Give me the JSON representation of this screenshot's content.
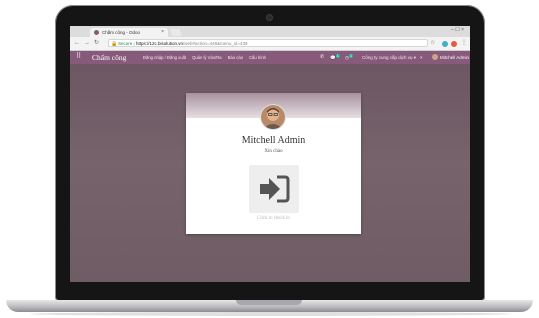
{
  "browser": {
    "tab_title": "Chấm công - Odoo",
    "tab_close": "×",
    "window_controls": "– ☐ ×",
    "address": {
      "secure_label": "Secure",
      "separator": "|",
      "host": "https://12c.bisolution.vn",
      "path": "/web#action=448&menu_id=439"
    }
  },
  "navbar": {
    "app_name": "Chấm công",
    "menu_items": [
      "Đăng nhập / Đăng xuất",
      "Quản lý Vào/Ra",
      "Báo cáo",
      "Cấu hình"
    ],
    "chat_badge": "1",
    "activity_badge": "1",
    "company": "Công ty cung cấp dịch vụ",
    "company_caret": "▾",
    "close": "×",
    "user": "Mitchell Admin ▾"
  },
  "checkin_card": {
    "employee_name": "Mitchell Admin",
    "greeting": "Xin chào",
    "hint": "Click to check in"
  },
  "icons": {
    "apps": "apps-grid-icon",
    "checkin": "sign-in-icon"
  },
  "colors": {
    "brand": "#875a7b",
    "checkin_icon": "#555555"
  }
}
